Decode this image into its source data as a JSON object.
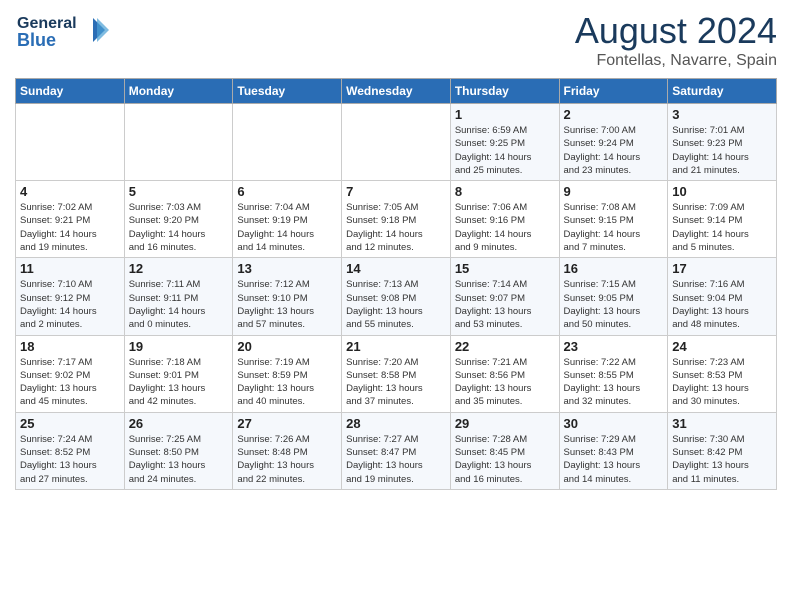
{
  "header": {
    "logo_line1": "General",
    "logo_line2": "Blue",
    "month_title": "August 2024",
    "location": "Fontellas, Navarre, Spain"
  },
  "weekdays": [
    "Sunday",
    "Monday",
    "Tuesday",
    "Wednesday",
    "Thursday",
    "Friday",
    "Saturday"
  ],
  "weeks": [
    [
      {
        "day": "",
        "info": ""
      },
      {
        "day": "",
        "info": ""
      },
      {
        "day": "",
        "info": ""
      },
      {
        "day": "",
        "info": ""
      },
      {
        "day": "1",
        "info": "Sunrise: 6:59 AM\nSunset: 9:25 PM\nDaylight: 14 hours\nand 25 minutes."
      },
      {
        "day": "2",
        "info": "Sunrise: 7:00 AM\nSunset: 9:24 PM\nDaylight: 14 hours\nand 23 minutes."
      },
      {
        "day": "3",
        "info": "Sunrise: 7:01 AM\nSunset: 9:23 PM\nDaylight: 14 hours\nand 21 minutes."
      }
    ],
    [
      {
        "day": "4",
        "info": "Sunrise: 7:02 AM\nSunset: 9:21 PM\nDaylight: 14 hours\nand 19 minutes."
      },
      {
        "day": "5",
        "info": "Sunrise: 7:03 AM\nSunset: 9:20 PM\nDaylight: 14 hours\nand 16 minutes."
      },
      {
        "day": "6",
        "info": "Sunrise: 7:04 AM\nSunset: 9:19 PM\nDaylight: 14 hours\nand 14 minutes."
      },
      {
        "day": "7",
        "info": "Sunrise: 7:05 AM\nSunset: 9:18 PM\nDaylight: 14 hours\nand 12 minutes."
      },
      {
        "day": "8",
        "info": "Sunrise: 7:06 AM\nSunset: 9:16 PM\nDaylight: 14 hours\nand 9 minutes."
      },
      {
        "day": "9",
        "info": "Sunrise: 7:08 AM\nSunset: 9:15 PM\nDaylight: 14 hours\nand 7 minutes."
      },
      {
        "day": "10",
        "info": "Sunrise: 7:09 AM\nSunset: 9:14 PM\nDaylight: 14 hours\nand 5 minutes."
      }
    ],
    [
      {
        "day": "11",
        "info": "Sunrise: 7:10 AM\nSunset: 9:12 PM\nDaylight: 14 hours\nand 2 minutes."
      },
      {
        "day": "12",
        "info": "Sunrise: 7:11 AM\nSunset: 9:11 PM\nDaylight: 14 hours\nand 0 minutes."
      },
      {
        "day": "13",
        "info": "Sunrise: 7:12 AM\nSunset: 9:10 PM\nDaylight: 13 hours\nand 57 minutes."
      },
      {
        "day": "14",
        "info": "Sunrise: 7:13 AM\nSunset: 9:08 PM\nDaylight: 13 hours\nand 55 minutes."
      },
      {
        "day": "15",
        "info": "Sunrise: 7:14 AM\nSunset: 9:07 PM\nDaylight: 13 hours\nand 53 minutes."
      },
      {
        "day": "16",
        "info": "Sunrise: 7:15 AM\nSunset: 9:05 PM\nDaylight: 13 hours\nand 50 minutes."
      },
      {
        "day": "17",
        "info": "Sunrise: 7:16 AM\nSunset: 9:04 PM\nDaylight: 13 hours\nand 48 minutes."
      }
    ],
    [
      {
        "day": "18",
        "info": "Sunrise: 7:17 AM\nSunset: 9:02 PM\nDaylight: 13 hours\nand 45 minutes."
      },
      {
        "day": "19",
        "info": "Sunrise: 7:18 AM\nSunset: 9:01 PM\nDaylight: 13 hours\nand 42 minutes."
      },
      {
        "day": "20",
        "info": "Sunrise: 7:19 AM\nSunset: 8:59 PM\nDaylight: 13 hours\nand 40 minutes."
      },
      {
        "day": "21",
        "info": "Sunrise: 7:20 AM\nSunset: 8:58 PM\nDaylight: 13 hours\nand 37 minutes."
      },
      {
        "day": "22",
        "info": "Sunrise: 7:21 AM\nSunset: 8:56 PM\nDaylight: 13 hours\nand 35 minutes."
      },
      {
        "day": "23",
        "info": "Sunrise: 7:22 AM\nSunset: 8:55 PM\nDaylight: 13 hours\nand 32 minutes."
      },
      {
        "day": "24",
        "info": "Sunrise: 7:23 AM\nSunset: 8:53 PM\nDaylight: 13 hours\nand 30 minutes."
      }
    ],
    [
      {
        "day": "25",
        "info": "Sunrise: 7:24 AM\nSunset: 8:52 PM\nDaylight: 13 hours\nand 27 minutes."
      },
      {
        "day": "26",
        "info": "Sunrise: 7:25 AM\nSunset: 8:50 PM\nDaylight: 13 hours\nand 24 minutes."
      },
      {
        "day": "27",
        "info": "Sunrise: 7:26 AM\nSunset: 8:48 PM\nDaylight: 13 hours\nand 22 minutes."
      },
      {
        "day": "28",
        "info": "Sunrise: 7:27 AM\nSunset: 8:47 PM\nDaylight: 13 hours\nand 19 minutes."
      },
      {
        "day": "29",
        "info": "Sunrise: 7:28 AM\nSunset: 8:45 PM\nDaylight: 13 hours\nand 16 minutes."
      },
      {
        "day": "30",
        "info": "Sunrise: 7:29 AM\nSunset: 8:43 PM\nDaylight: 13 hours\nand 14 minutes."
      },
      {
        "day": "31",
        "info": "Sunrise: 7:30 AM\nSunset: 8:42 PM\nDaylight: 13 hours\nand 11 minutes."
      }
    ]
  ]
}
